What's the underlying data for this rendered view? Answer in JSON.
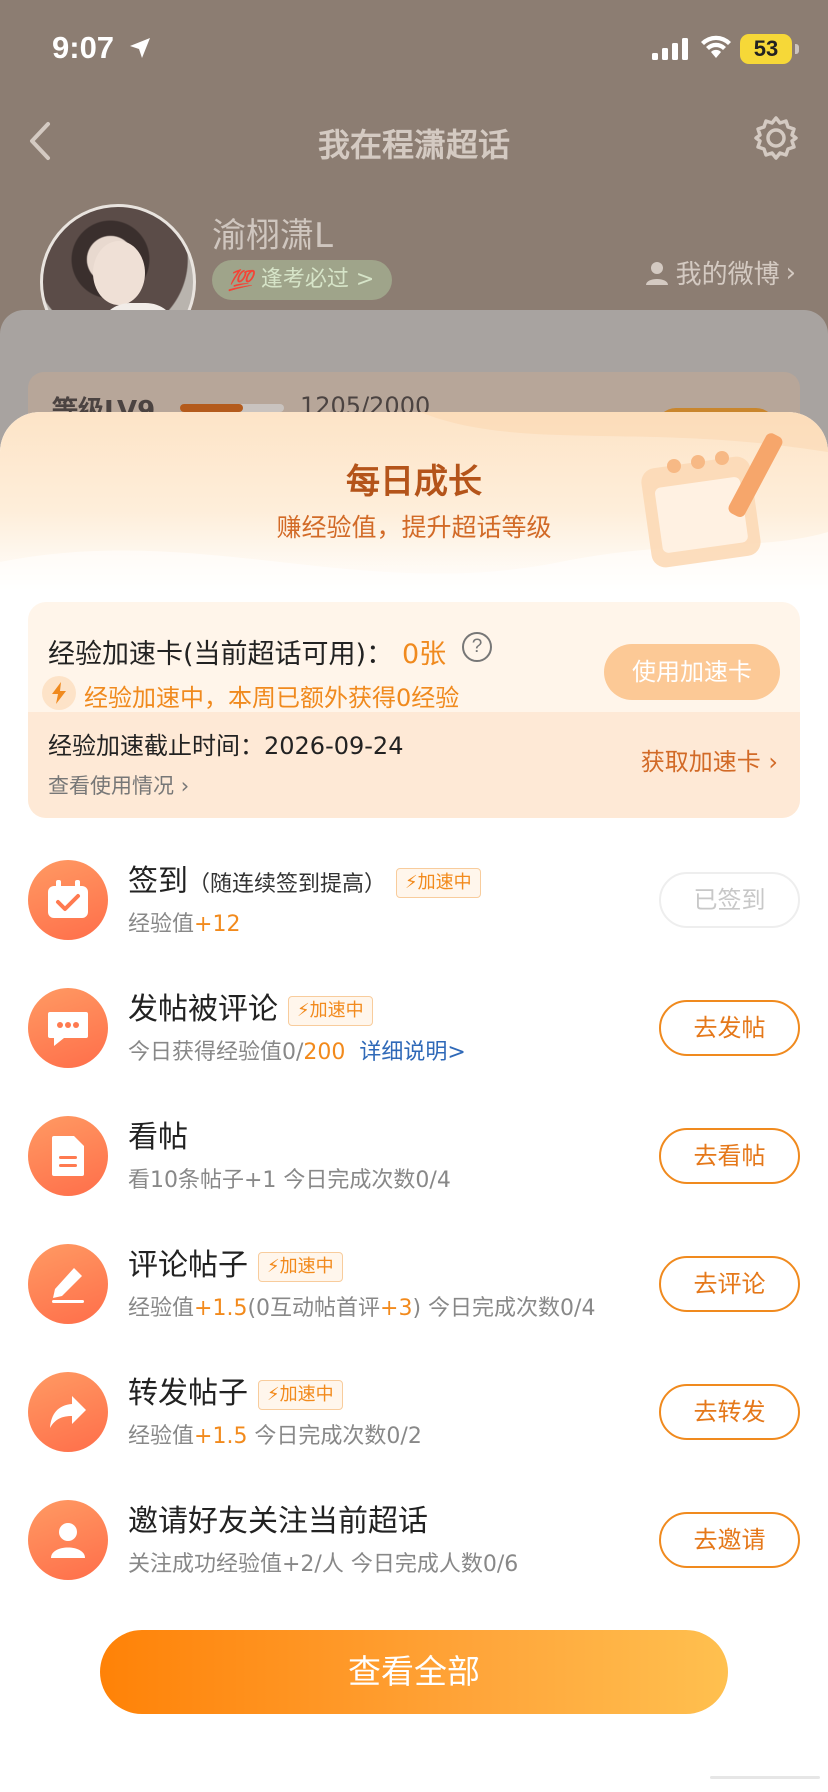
{
  "status_bar": {
    "time": "9:07",
    "battery": "53"
  },
  "background": {
    "nav_title": "我在程潇超话",
    "username": "渝栩潇L",
    "tag": {
      "icon_text": "💯",
      "label": "逢考必过 >"
    },
    "my_weibo": "我的微博",
    "level_label": "等级LV9",
    "level_progress_text": "1205/2000",
    "level_progress": 0.6025
  },
  "sheet": {
    "title": "每日成长",
    "subtitle": "赚经验值，提升超话等级",
    "boost_card": {
      "title": "经验加速卡(当前超话可用)：",
      "count": "0张",
      "help": "?",
      "status": "经验加速中，本周已额外获得0经验",
      "use_button": "使用加速卡",
      "deadline": "经验加速截止时间：2026-09-24",
      "view_usage": "查看使用情况",
      "get_card": "获取加速卡"
    },
    "boost_badge": "加速中",
    "tasks": [
      {
        "name": "签到",
        "note": "（随连续签到提高）",
        "desc_prefix": "经验值",
        "desc_hl": "+12",
        "button": "已签到",
        "done": true,
        "icon": "calendar-check-icon"
      },
      {
        "name": "发帖被评论",
        "desc_prefix": "今日获得经验值0/",
        "desc_hl": "200",
        "link": "详细说明>",
        "button": "去发帖",
        "icon": "chat-bubble-icon"
      },
      {
        "name": "看帖",
        "desc_prefix": "看10条帖子+1   今日完成次数0/4",
        "button": "去看帖",
        "icon": "document-icon"
      },
      {
        "name": "评论帖子",
        "desc_prefix": "经验值",
        "desc_hl": "+1.5",
        "desc_mid": "(0互动帖首评",
        "desc_hl2": "+3",
        "desc_suffix": ")   今日完成次数0/4",
        "button": "去评论",
        "icon": "pencil-icon"
      },
      {
        "name": "转发帖子",
        "desc_prefix": "经验值",
        "desc_hl": "+1.5",
        "desc_suffix": "   今日完成次数0/2",
        "button": "去转发",
        "icon": "share-arrow-icon"
      },
      {
        "name": "邀请好友关注当前超话",
        "desc_prefix": "关注成功经验值+2/人   今日完成人数0/6",
        "button": "去邀请",
        "icon": "user-icon"
      }
    ],
    "view_all": "查看全部"
  },
  "colors": {
    "accent": "#f08a1e",
    "link": "#2f69b8",
    "sheet_title": "#b4541a"
  }
}
